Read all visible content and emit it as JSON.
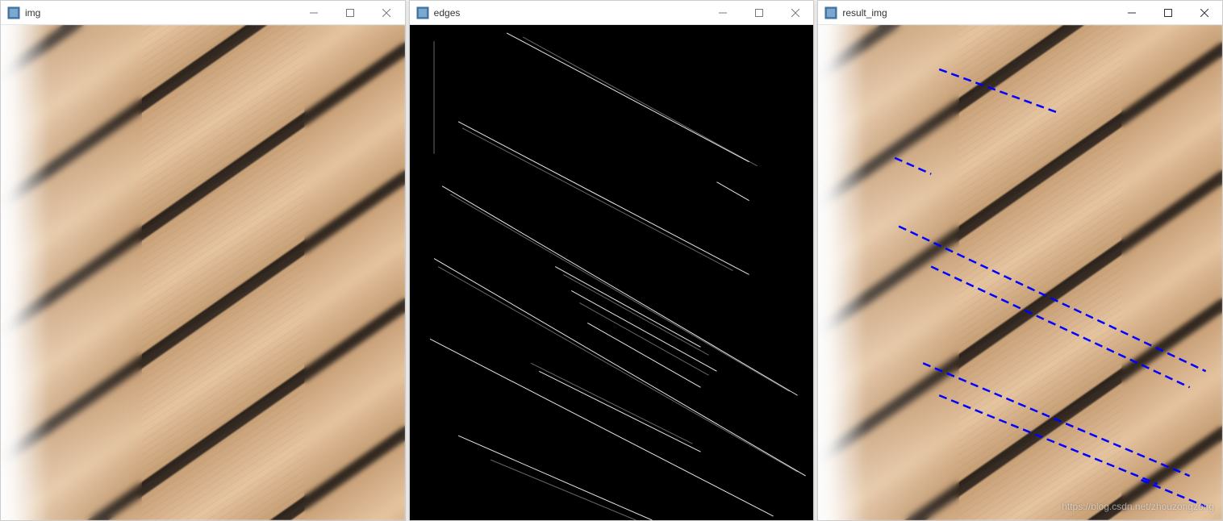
{
  "windows": [
    {
      "title": "img",
      "content_type": "wood"
    },
    {
      "title": "edges",
      "content_type": "edges"
    },
    {
      "title": "result_img",
      "content_type": "wood_with_lines"
    }
  ],
  "watermark": "https://blog.csdn.net/zhouzongzong",
  "colors": {
    "edge_detected_line": "#0000ff",
    "canny_background": "#000000",
    "canny_edge": "#ffffff"
  }
}
